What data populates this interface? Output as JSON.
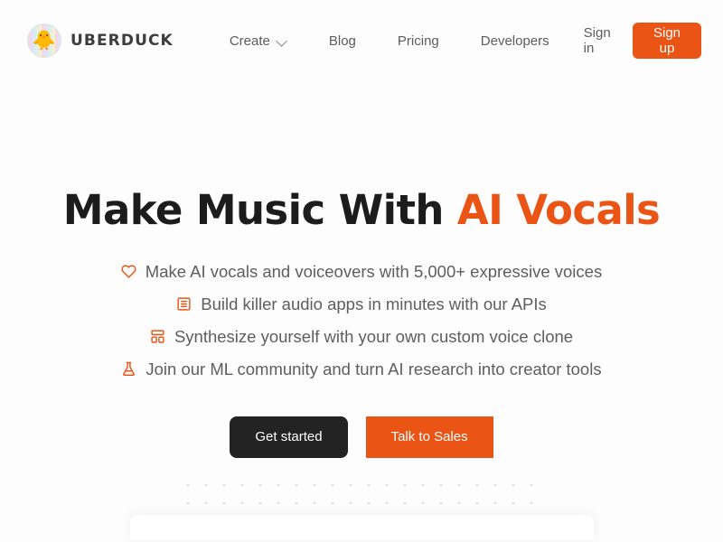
{
  "header": {
    "brand": {
      "name": "UBERDUCK",
      "logo_icon": "duck-logo-icon"
    },
    "nav": [
      {
        "label": "Create",
        "has_dropdown": true,
        "icon": "chevron-down-icon"
      },
      {
        "label": "Blog",
        "has_dropdown": false
      },
      {
        "label": "Pricing",
        "has_dropdown": false
      },
      {
        "label": "Developers",
        "has_dropdown": false
      }
    ],
    "sign_in_label": "Sign in",
    "sign_up_label": "Sign up"
  },
  "hero": {
    "headline_main": "Make Music With ",
    "headline_accent": "AI Vocals",
    "features": [
      {
        "icon": "heart-icon",
        "text": "Make AI vocals and voiceovers with 5,000+ expressive voices"
      },
      {
        "icon": "list-box-icon",
        "text": "Build killer audio apps in minutes with our APIs"
      },
      {
        "icon": "layout-grid-icon",
        "text": "Synthesize yourself with your own custom voice clone"
      },
      {
        "icon": "flask-icon",
        "text": "Join our ML community and turn AI research into creator tools"
      }
    ],
    "cta": {
      "primary_label": "Get started",
      "secondary_label": "Talk to Sales"
    }
  },
  "colors": {
    "accent_orange": "#ea5516",
    "dark_button": "#232323",
    "body_text": "#5e5e5e",
    "headline": "#1c1c1c",
    "page_background": "#fdfdfd",
    "dot_grid": "#dcdcdd"
  }
}
